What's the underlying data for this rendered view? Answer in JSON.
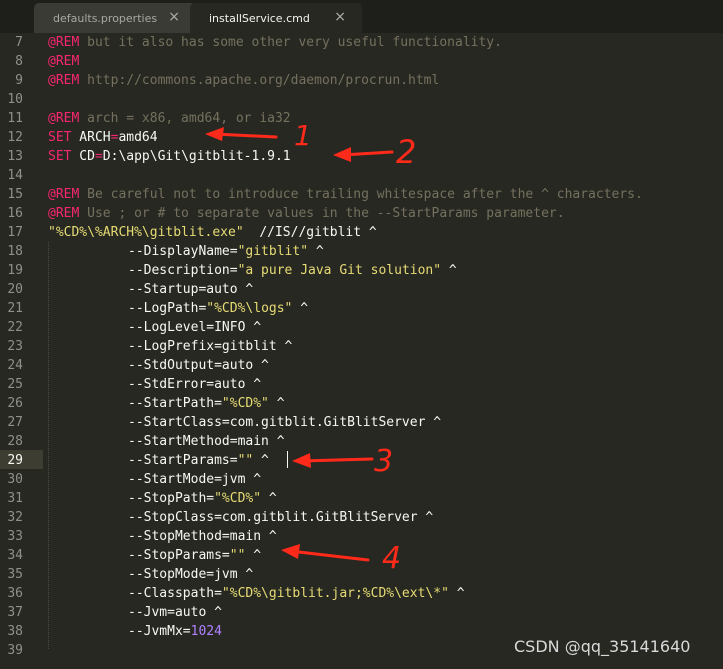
{
  "tabs": [
    {
      "label": "defaults.properties",
      "close": "×",
      "active": false
    },
    {
      "label": "installService.cmd",
      "close": "×",
      "active": true
    }
  ],
  "gutter": {
    "line_numbers": [
      "7",
      "8",
      "9",
      "10",
      "11",
      "12",
      "13",
      "14",
      "15",
      "16",
      "17",
      "18",
      "19",
      "20",
      "21",
      "22",
      "23",
      "24",
      "25",
      "26",
      "27",
      "28",
      "29",
      "30",
      "31",
      "32",
      "33",
      "34",
      "35",
      "36",
      "37",
      "38",
      "39"
    ],
    "current_line": "29"
  },
  "code": {
    "line7": {
      "kw": "@REM",
      "rest": " but it also has some other very useful functionality."
    },
    "line8": {
      "kw": "@REM"
    },
    "line9": {
      "kw": "@REM",
      "rest": " http://commons.apache.org/daemon/procrun.html"
    },
    "line11": {
      "kw": "@REM",
      "rest": " arch = x86, amd64, or ia32"
    },
    "line12": {
      "kw": "SET",
      "name": " ARCH",
      "op": "=",
      "value": "amd64"
    },
    "line13": {
      "kw": "SET",
      "name": " CD",
      "op": "=",
      "value": "D:\\app\\Git\\gitblit-1.9.1"
    },
    "line15": {
      "kw": "@REM",
      "rest": " Be careful not to introduce trailing whitespace after the ^ characters."
    },
    "line16": {
      "kw": "@REM",
      "rest": " Use ; or # to separate values in the --StartParams parameter."
    },
    "line17": {
      "str": "\"%CD%\\%ARCH%\\gitblit.exe\"",
      "rest": "  //IS//gitblit ^"
    },
    "line18": {
      "a": "--DisplayName=",
      "b": "\"gitblit\"",
      "c": " ^"
    },
    "line19": {
      "a": "--Description=",
      "b": "\"a pure Java Git solution\"",
      "c": " ^"
    },
    "line20": {
      "a": "--Startup=auto ^"
    },
    "line21": {
      "a": "--LogPath=",
      "b": "\"%CD%\\logs\"",
      "c": " ^"
    },
    "line22": {
      "a": "--LogLevel=INFO ^"
    },
    "line23": {
      "a": "--LogPrefix=gitblit ^"
    },
    "line24": {
      "a": "--StdOutput=auto ^"
    },
    "line25": {
      "a": "--StdError=auto ^"
    },
    "line26": {
      "a": "--StartPath=",
      "b": "\"%CD%\"",
      "c": " ^"
    },
    "line27": {
      "a": "--StartClass=com.gitblit.GitBlitServer ^"
    },
    "line28": {
      "a": "--StartMethod=main ^"
    },
    "line29": {
      "a": "--StartParams=",
      "b": "\"\"",
      "c": " ^"
    },
    "line30": {
      "a": "--StartMode=jvm ^"
    },
    "line31": {
      "a": "--StopPath=",
      "b": "\"%CD%\"",
      "c": " ^"
    },
    "line32": {
      "a": "--StopClass=com.gitblit.GitBlitServer ^"
    },
    "line33": {
      "a": "--StopMethod=main ^"
    },
    "line34": {
      "a": "--StopParams=",
      "b": "\"\"",
      "c": " ^"
    },
    "line35": {
      "a": "--StopMode=jvm ^"
    },
    "line36": {
      "a": "--Classpath=",
      "b": "\"%CD%\\gitblit.jar;%CD%\\ext\\*\"",
      "c": " ^"
    },
    "line37": {
      "a": "--Jvm=auto ^"
    },
    "line38": {
      "a": "--JvmMx=",
      "n": "1024"
    }
  },
  "annotations": [
    "1",
    "2",
    "3",
    "4"
  ],
  "watermark": "CSDN @qq_35141640",
  "colors": {
    "background": "#272822",
    "comment": "#75715e",
    "keyword": "#f92672",
    "string": "#e6db74",
    "number": "#ae81ff",
    "annotation": "#ff2a1a"
  }
}
